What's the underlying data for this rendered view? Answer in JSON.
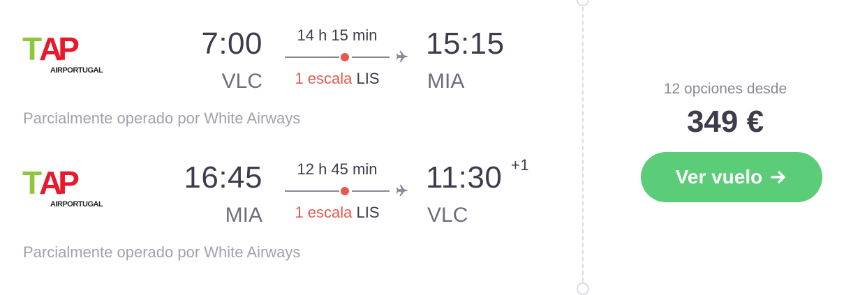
{
  "legs": [
    {
      "airline_logo": {
        "name": "TAP Air Portugal",
        "wordmark": "AIRPORTUGAL",
        "mark": "TAP"
      },
      "departure_time": "7:00",
      "departure_code": "VLC",
      "duration": "14 h 15 min",
      "stops_label": "1 escala",
      "stop_airport": "LIS",
      "arrival_time": "15:15",
      "arrival_day_offset": "",
      "arrival_code": "MIA",
      "operated_by": "Parcialmente operado por White Airways"
    },
    {
      "airline_logo": {
        "name": "TAP Air Portugal",
        "wordmark": "AIRPORTUGAL",
        "mark": "TAP"
      },
      "departure_time": "16:45",
      "departure_code": "MIA",
      "duration": "12 h 45 min",
      "stops_label": "1 escala",
      "stop_airport": "LIS",
      "arrival_time": "11:30",
      "arrival_day_offset": "+1",
      "arrival_code": "VLC",
      "operated_by": "Parcialmente operado por White Airways"
    }
  ],
  "offer": {
    "options_text": "12 opciones desde",
    "price": "349 €",
    "cta_label": "Ver vuelo"
  },
  "colors": {
    "accent_green": "#5bcc78",
    "stop_red": "#e8584f",
    "logo_green": "#8fc63d",
    "logo_red": "#e8192c"
  },
  "icons": [
    "plane-icon",
    "arrow-right-icon"
  ]
}
